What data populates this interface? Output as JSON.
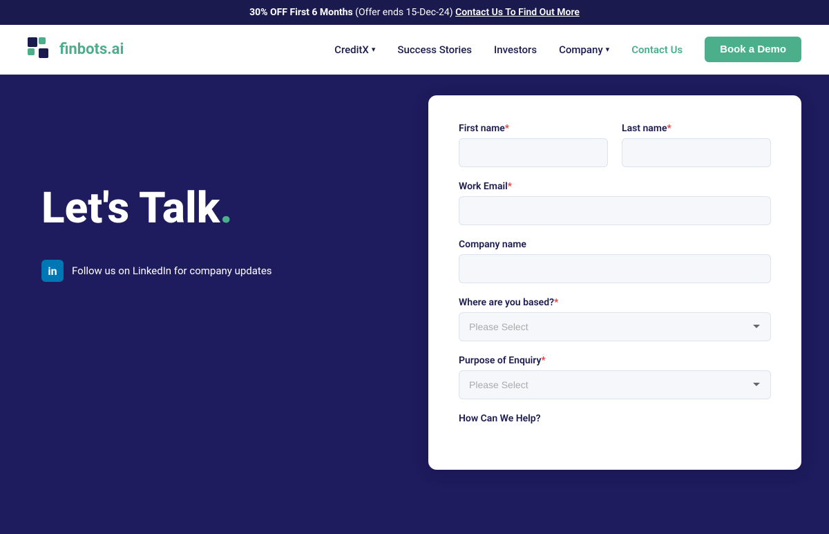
{
  "banner": {
    "text_bold": "30% OFF First 6 Months",
    "text_regular": " (Offer ends 15-Dec-24) ",
    "link_text": "Contact Us To Find Out More"
  },
  "header": {
    "logo_text_main": "finbots.",
    "logo_text_accent": "ai",
    "nav": {
      "items": [
        {
          "label": "CreditX",
          "has_dropdown": true
        },
        {
          "label": "Success Stories",
          "has_dropdown": false
        },
        {
          "label": "Investors",
          "has_dropdown": false
        },
        {
          "label": "Company",
          "has_dropdown": true
        },
        {
          "label": "Contact Us",
          "is_green": true,
          "has_dropdown": false
        }
      ],
      "demo_button": "Book a Demo"
    }
  },
  "hero": {
    "title": "Let's Talk",
    "dot": ".",
    "linkedin_text": "Follow us on LinkedIn for company updates"
  },
  "form": {
    "first_name_label": "First name",
    "last_name_label": "Last name",
    "email_label": "Work Email",
    "company_label": "Company name",
    "location_label": "Where are you based?",
    "enquiry_label": "Purpose of Enquiry",
    "help_label": "How Can We Help?",
    "select_placeholder": "Please Select",
    "first_name_placeholder": "",
    "last_name_placeholder": "",
    "email_placeholder": "",
    "company_placeholder": ""
  }
}
